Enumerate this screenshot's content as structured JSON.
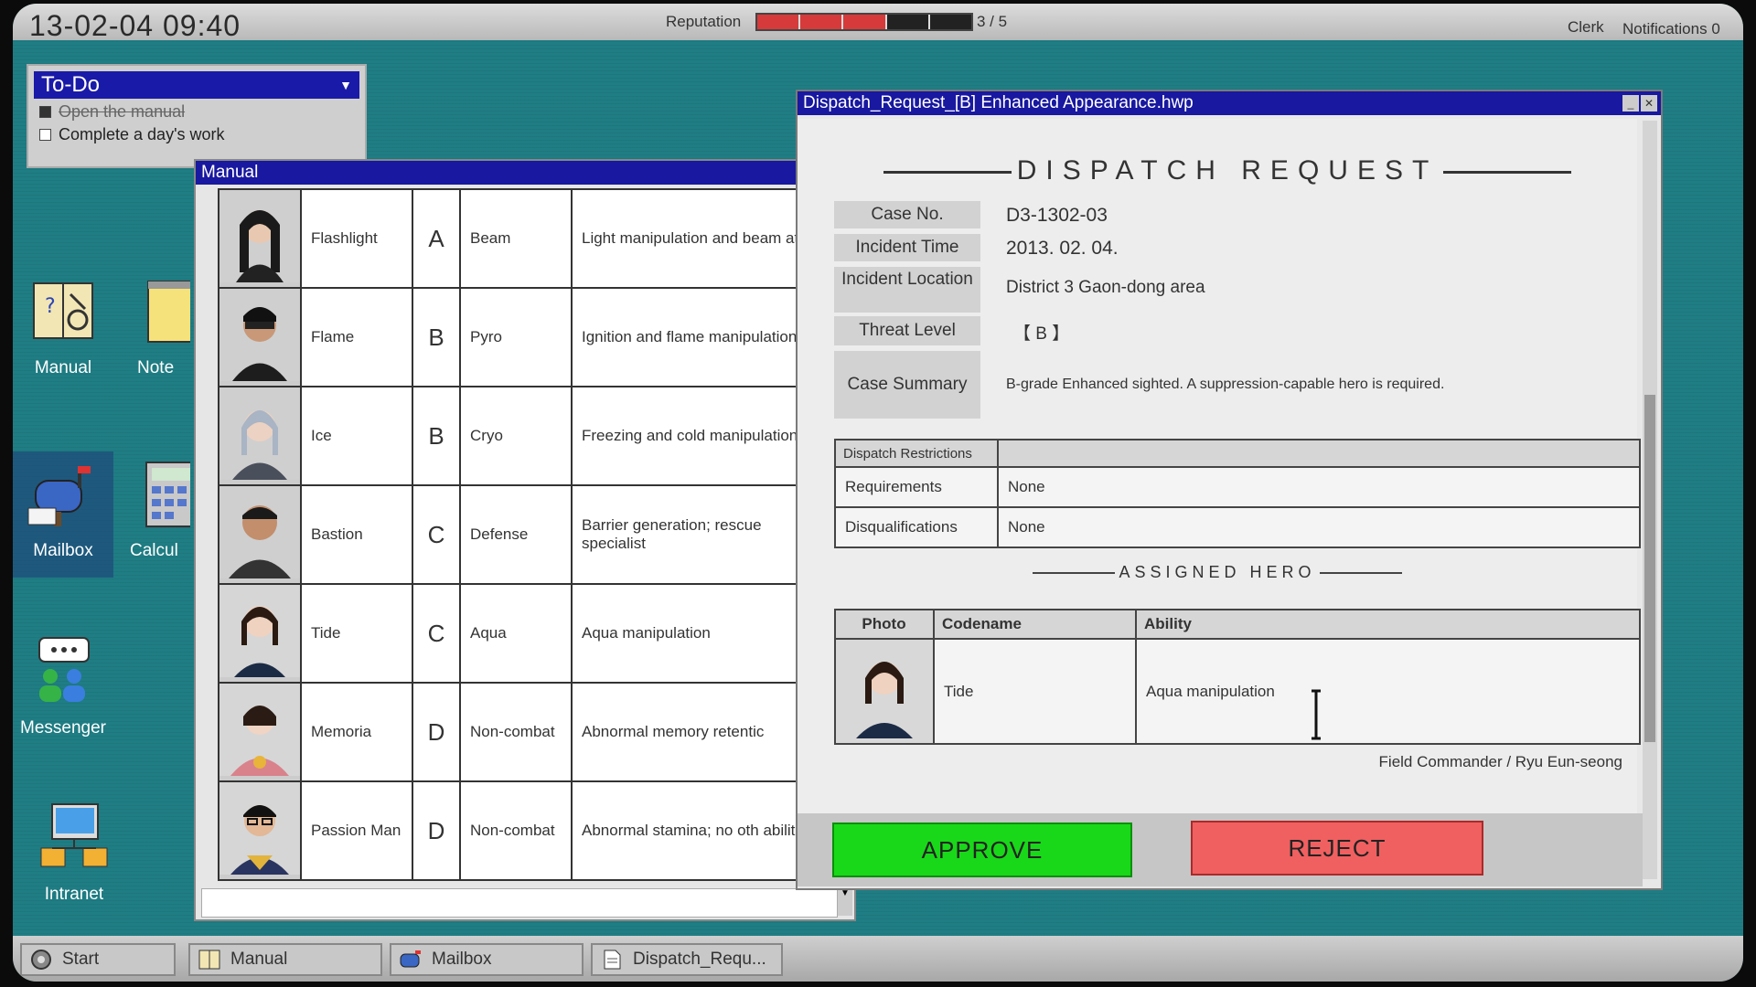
{
  "topbar": {
    "clock": "13-02-04  09:40",
    "reputation_label": "Reputation",
    "reputation_value": "3 / 5",
    "reputation_level": 3,
    "reputation_max": 5,
    "reputation_color": "#d63a3a",
    "clerk": "Clerk",
    "notifications": "Notifications 0"
  },
  "todo": {
    "title": "To-Do",
    "items": [
      {
        "label": "Open the manual",
        "done": true
      },
      {
        "label": "Complete a day's work",
        "done": false
      }
    ]
  },
  "desktop": {
    "icons": [
      {
        "label": "Manual",
        "icon": "manual-book-icon"
      },
      {
        "label": "Note",
        "icon": "notepad-icon"
      },
      {
        "label": "Mailbox",
        "icon": "mailbox-icon"
      },
      {
        "label": "Calcul",
        "icon": "calculator-icon"
      },
      {
        "label": "Messenger",
        "icon": "messenger-icon"
      },
      {
        "label": "Intranet",
        "icon": "intranet-icon"
      }
    ]
  },
  "manual": {
    "title": "Manual",
    "rows": [
      {
        "name": "Flashlight",
        "grade": "A",
        "type": "Beam",
        "ability": "Light manipulation and beam attack"
      },
      {
        "name": "Flame",
        "grade": "B",
        "type": "Pyro",
        "ability": "Ignition and flame manipulation"
      },
      {
        "name": "Ice",
        "grade": "B",
        "type": "Cryo",
        "ability": "Freezing and cold manipulation"
      },
      {
        "name": "Bastion",
        "grade": "C",
        "type": "Defense",
        "ability": "Barrier generation; rescue specialist"
      },
      {
        "name": "Tide",
        "grade": "C",
        "type": "Aqua",
        "ability": "Aqua manipulation"
      },
      {
        "name": "Memoria",
        "grade": "D",
        "type": "Non-combat",
        "ability": "Abnormal memory retentic"
      },
      {
        "name": "Passion Man",
        "grade": "D",
        "type": "Non-combat",
        "ability": "Abnormal stamina; no oth abilities."
      }
    ]
  },
  "dispatch": {
    "window_title": "Dispatch_Request_[B] Enhanced Appearance.hwp",
    "heading": "DISPATCH REQUEST",
    "case_no_label": "Case No.",
    "case_no": "D3-1302-03",
    "incident_time_label": "Incident Time",
    "incident_time": "2013. 02. 04.",
    "incident_location_label": "Incident Location",
    "incident_location": "District 3 Gaon-dong area",
    "threat_level_label": "Threat Level",
    "threat_level": "【 B 】",
    "case_summary_label": "Case Summary",
    "case_summary": "B-grade Enhanced sighted. A suppression-capable hero is required.",
    "restrictions_header": "Dispatch Restrictions",
    "requirements_label": "Requirements",
    "requirements": "None",
    "disqualifications_label": "Disqualifications",
    "disqualifications": "None",
    "assigned_heading": "ASSIGNED HERO",
    "hero_cols": [
      "Photo",
      "Codename",
      "Ability"
    ],
    "hero_codename": "Tide",
    "hero_ability": "Aqua manipulation",
    "signature": "Field Commander / Ryu Eun-seong",
    "approve": "APPROVE",
    "reject": "REJECT"
  },
  "taskbar": {
    "start": "Start",
    "items": [
      "Manual",
      "Mailbox",
      "Dispatch_Requ..."
    ]
  }
}
